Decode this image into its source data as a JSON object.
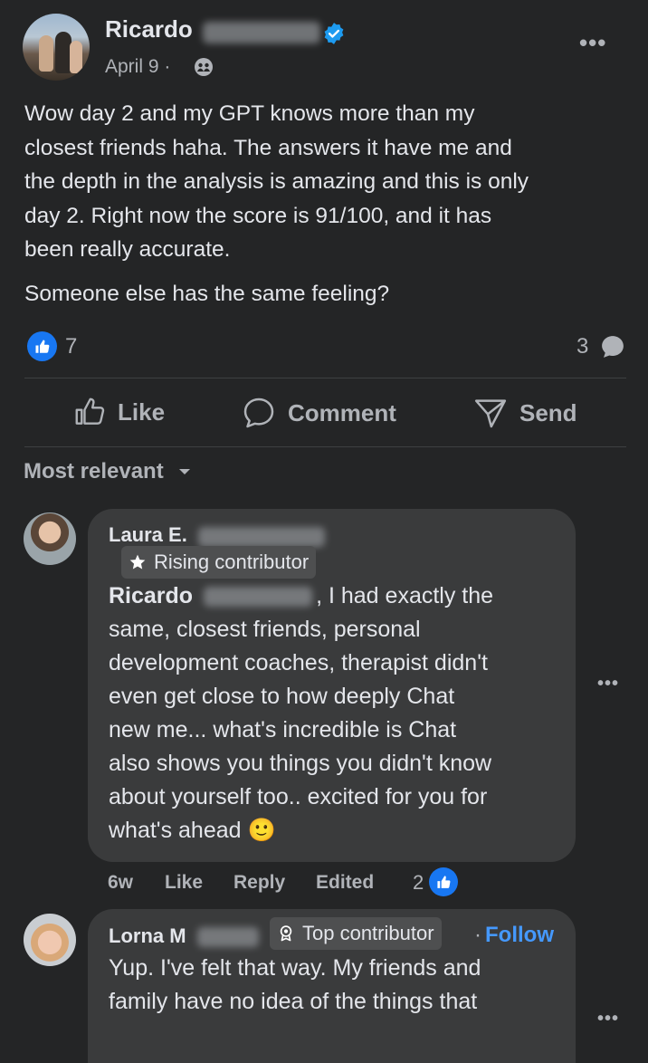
{
  "post": {
    "author_first": "Ricardo",
    "date": "April 9 ·",
    "body_lines": [
      "Wow day 2 and my GPT knows more than my",
      "closest friends haha. The answers it have me and",
      "the depth in the analysis is amazing and this is only",
      "day 2. Right now the score is 91/100, and it has",
      "been really accurate."
    ],
    "body_second": "Someone else has the same feeling?",
    "reactions_count": "7",
    "comments_count": "3"
  },
  "actions": {
    "like": "Like",
    "comment": "Comment",
    "send": "Send"
  },
  "sort": {
    "label": "Most relevant"
  },
  "comments": [
    {
      "author": "Laura E.",
      "badge": "Rising contributor",
      "mention": "Ricardo",
      "text_lines": [
        ", I had exactly the",
        "same, closest friends, personal",
        "development coaches, therapist didn't",
        "even get close to how deeply Chat",
        "new me... what's incredible is Chat",
        "also shows you things you didn't know",
        "about yourself too.. excited for you for",
        "what's ahead"
      ],
      "emoji": "🙂",
      "time": "6w",
      "like": "Like",
      "reply": "Reply",
      "edited": "Edited",
      "reactions": "2"
    },
    {
      "author": "Lorna M",
      "badge": "Top contributor",
      "follow_sep": "·",
      "follow": "Follow",
      "text_lines": [
        "Yup. I've felt that way. My friends and",
        "family have no idea of the things that"
      ]
    }
  ],
  "colors": {
    "background": "#242526",
    "bubble": "#3a3b3c",
    "accent": "#1877f2",
    "link": "#4599ff",
    "verified": "#1d9bf0"
  }
}
